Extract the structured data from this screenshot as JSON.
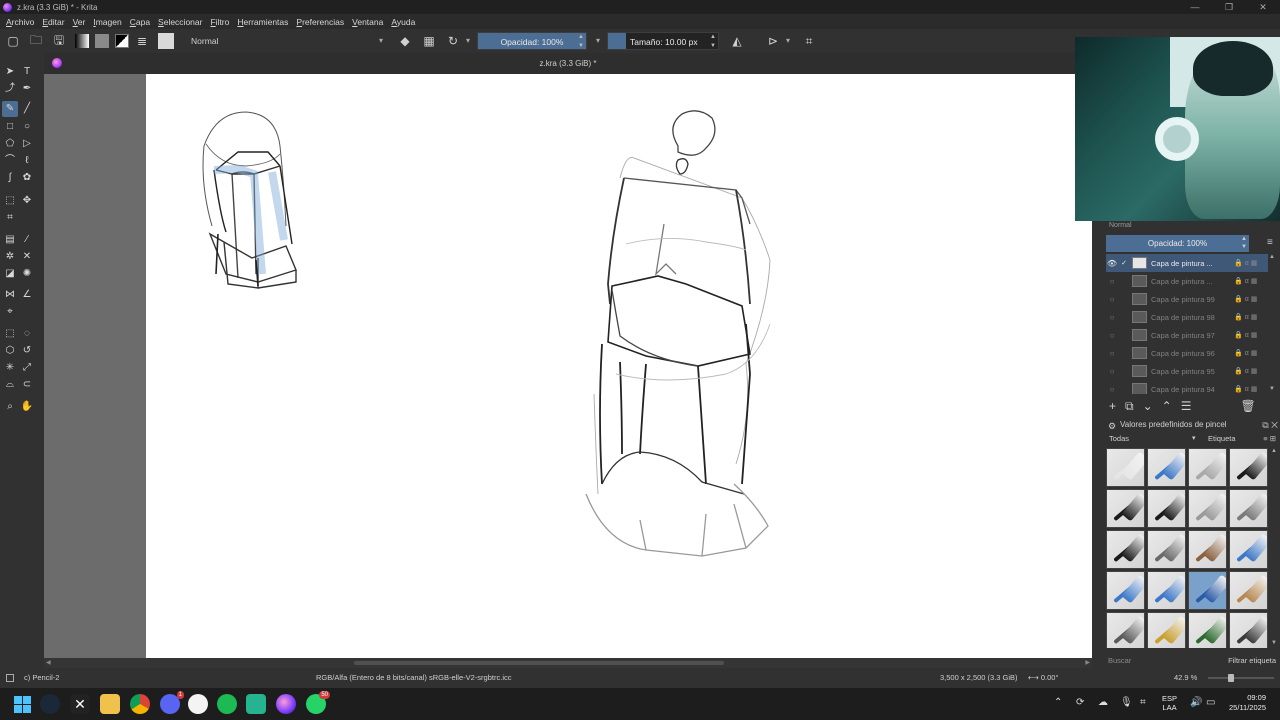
{
  "window": {
    "title": "z.kra (3.3 GiB) * - Krita",
    "controls": [
      "—",
      "❐",
      "✕"
    ]
  },
  "menu": [
    "Archivo",
    "Editar",
    "Ver",
    "Imagen",
    "Capa",
    "Seleccionar",
    "Filtro",
    "Herramientas",
    "Preferencias",
    "Ventana",
    "Ayuda"
  ],
  "toolbar": {
    "blend_mode": "Normal",
    "opacity_label": "Opacidad: 100%",
    "opacity_value": 1.0,
    "size_label": "Tamaño: 10.00 px"
  },
  "document": {
    "tab_title": "z.kra (3.3 GiB) *"
  },
  "layers_panel": {
    "blend_mode": "Normal",
    "opacity_label": "Opacidad: 100%",
    "layers": [
      {
        "name": "Capa de pintura ...",
        "active": true
      },
      {
        "name": "Capa de pintura ...",
        "active": false
      },
      {
        "name": "Capa de pintura 99",
        "active": false
      },
      {
        "name": "Capa de pintura 98",
        "active": false
      },
      {
        "name": "Capa de pintura 97",
        "active": false
      },
      {
        "name": "Capa de pintura 96",
        "active": false
      },
      {
        "name": "Capa de pintura 95",
        "active": false
      },
      {
        "name": "Capa de pintura 94",
        "active": false
      }
    ]
  },
  "brush_presets": {
    "title": "Valores predefinidos de pincel",
    "filter_all": "Todas",
    "tag_label": "Etiqueta",
    "search_placeholder": "Buscar",
    "filter_tag": "Filtrar etiqueta",
    "selected_index": 14,
    "tip_colors": [
      "#e6e6e6",
      "#3d78c8",
      "#a8a8a8",
      "#1a1a1a",
      "#1a1a1a",
      "#1a1a1a",
      "#9a9a9a",
      "#7a7a7a",
      "#1a1a1a",
      "#6a6a6a",
      "#8a6040",
      "#3d78c8",
      "#3d78c8",
      "#3d78c8",
      "#2a5aa8",
      "#b88850",
      "#5a5a5a",
      "#c8a030",
      "#2d6a2d",
      "#3a3a3a"
    ]
  },
  "status": {
    "tool": "c) Pencil-2",
    "color_model": "RGB/Alfa (Entero de 8 bits/canal)  sRGB-elle-V2-srgbtrc.icc",
    "dimensions": "3,500 x 2,500 (3.3 GiB)",
    "rotation": "0.00°",
    "zoom": "42.9 %"
  },
  "taskbar": {
    "badge_discord": "1",
    "badge_whatsapp": "50",
    "lang_line1": "ESP",
    "lang_line2": "LAA",
    "time": "09:09",
    "date": "25/11/2025"
  },
  "colors": {
    "accent": "#4d6e94",
    "canvas": "#ffffff",
    "ui_bg": "#313131"
  }
}
